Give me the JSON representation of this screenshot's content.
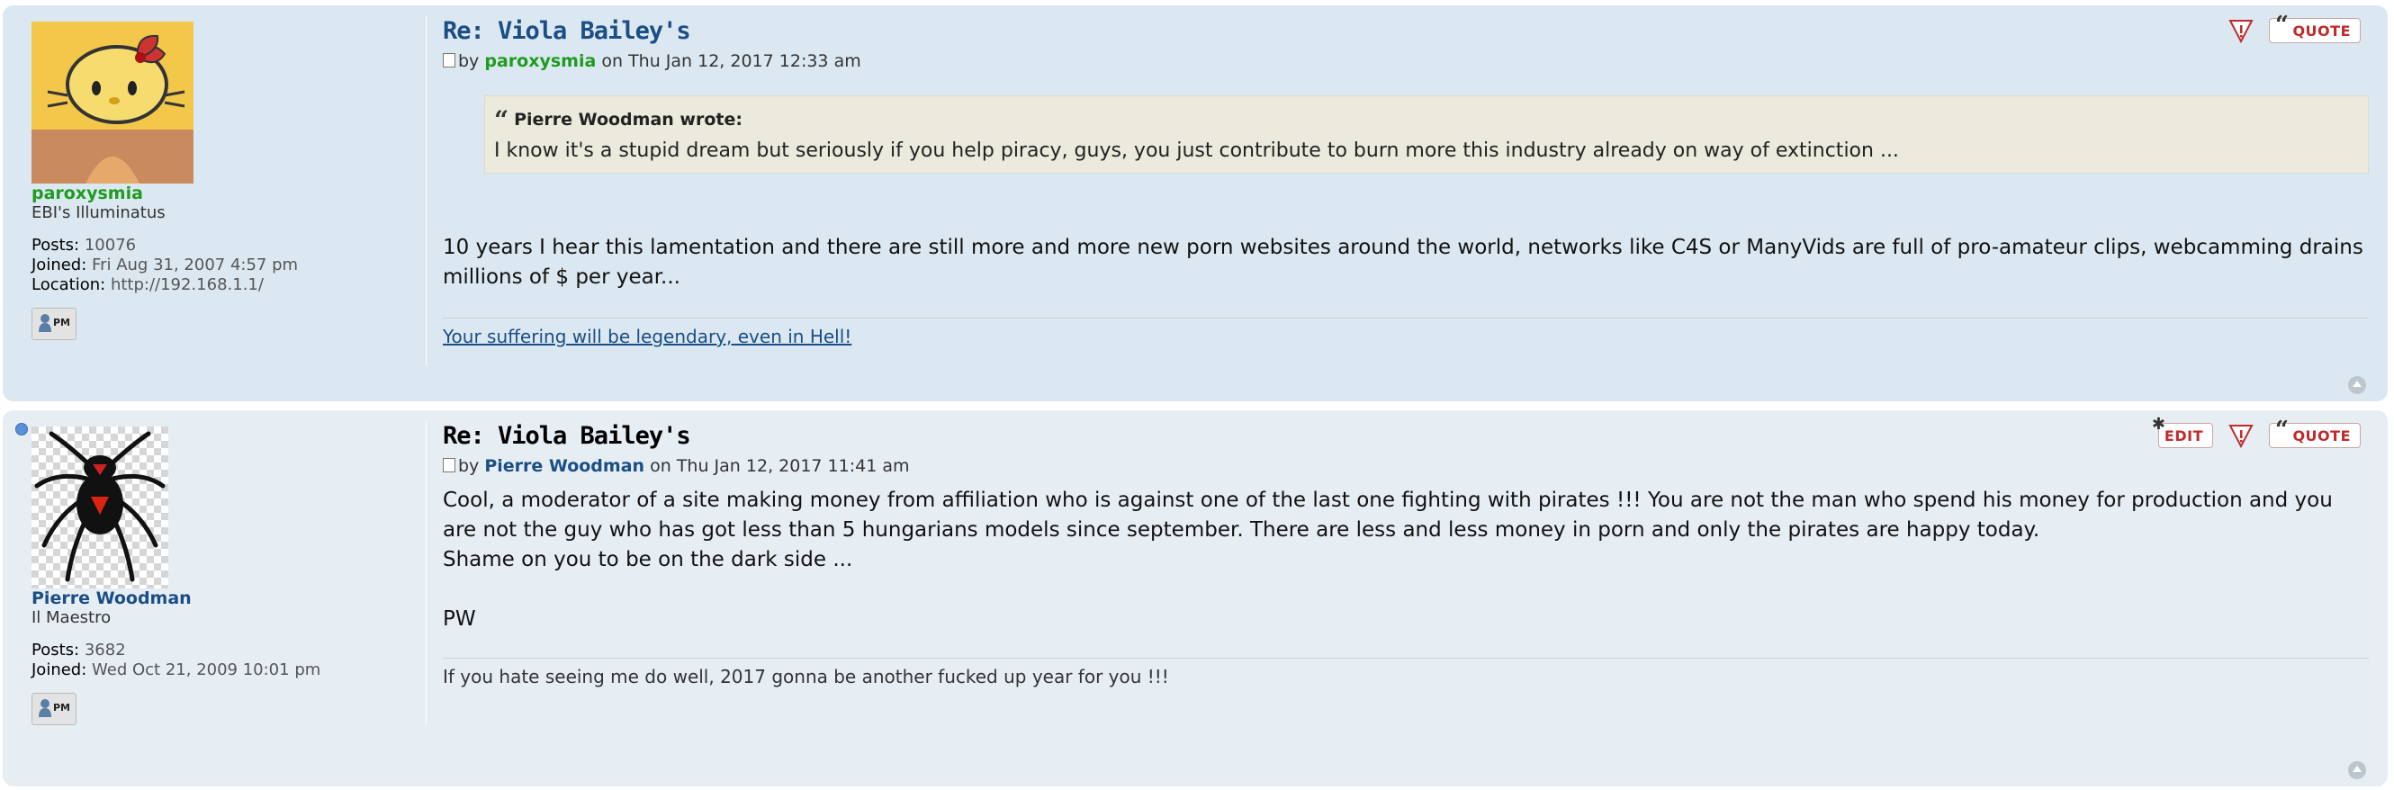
{
  "posts": [
    {
      "title": "Re: Viola Bailey's",
      "by": "by",
      "author": "paroxysmia",
      "on": "on",
      "datetime": "Thu Jan 12, 2017 12:33 am",
      "profile": {
        "username": "paroxysmia",
        "rank": "EBI's Illuminatus",
        "posts_label": "Posts:",
        "posts_value": "10076",
        "joined_label": "Joined:",
        "joined_value": "Fri Aug 31, 2007 4:57 pm",
        "location_label": "Location:",
        "location_value": "http://192.168.1.1/",
        "pm_label": "PM"
      },
      "quote": {
        "author_line": "Pierre Woodman wrote:",
        "text": "I know it's a stupid dream but seriously if you help piracy, guys, you just contribute to burn more this industry already on way of extinction ..."
      },
      "content": "10 years I hear this lamentation and there are still more and more new porn websites around the world, networks like C4S or ManyVids are full of pro-amateur clips, webcamming drains millions of $ per year...",
      "signature": "Your suffering will be legendary, even in Hell!",
      "buttons": {
        "quote": "QUOTE"
      }
    },
    {
      "title": "Re: Viola Bailey's",
      "by": "by",
      "author": "Pierre Woodman",
      "on": "on",
      "datetime": "Thu Jan 12, 2017 11:41 am",
      "profile": {
        "username": "Pierre Woodman",
        "rank": "Il Maestro",
        "posts_label": "Posts:",
        "posts_value": "3682",
        "joined_label": "Joined:",
        "joined_value": "Wed Oct 21, 2009 10:01 pm",
        "pm_label": "PM"
      },
      "content_lines": [
        "Cool, a moderator of a site making money from affiliation who is against one of the last one fighting with pirates !!! You are not the man who spend his money for production and you are not the guy who has got less than 5 hungarians models since september. There are less and less money in porn and only the pirates are happy today.",
        "Shame on you to be on the dark side ...",
        "",
        "PW"
      ],
      "signature": "If you hate seeing me do well, 2017 gonna be another fucked up year for you !!!",
      "buttons": {
        "edit": "EDIT",
        "quote": "QUOTE"
      }
    }
  ],
  "colors": {
    "post_bg_1": "#dce8f1",
    "post_bg_2": "#e6eef4",
    "username_green": "#1f9b1f",
    "username_blue": "#1a4e85",
    "button_red": "#c02a2a"
  },
  "icons": [
    "report-icon",
    "quote-icon",
    "edit-icon",
    "pm-icon",
    "back-to-top-icon",
    "online-status-icon",
    "post-icon"
  ]
}
